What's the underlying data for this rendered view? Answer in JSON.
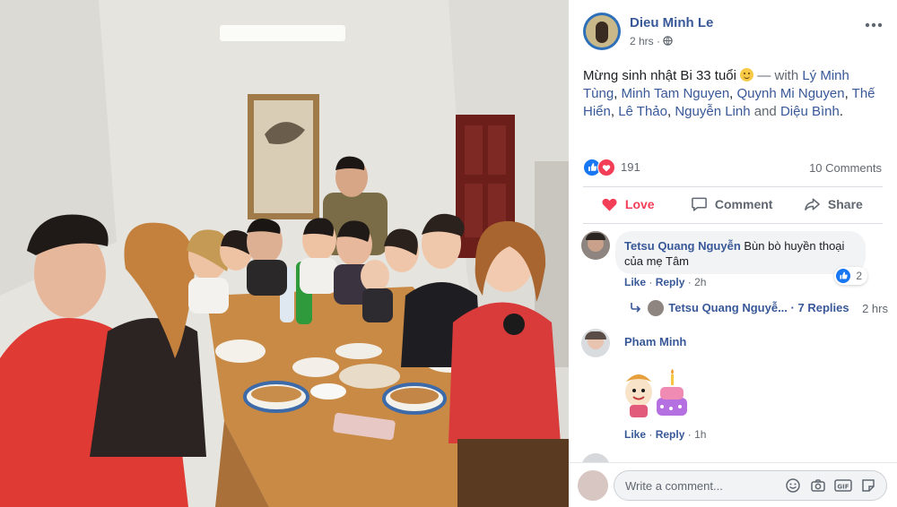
{
  "post": {
    "author": "Dieu Minh Le",
    "time": "2 hrs",
    "caption_main": "Mừng sinh nhật Bi 33 tuổi",
    "with_word": "— with",
    "tagged": [
      "Lý Minh Tùng",
      "Minh Tam Nguyen",
      "Quynh Mi Nguyen",
      "Thế Hiển",
      "Lê Thảo",
      "Nguyễn Linh"
    ],
    "and_word": "and",
    "last_tagged": "Diệu Bình",
    "reaction_count": "191",
    "comments_count": "10 Comments",
    "actions": {
      "love": "Love",
      "comment": "Comment",
      "share": "Share"
    }
  },
  "comments": [
    {
      "author": "Tetsu Quang Nguyễn",
      "text_line1": "Bùn bò huyền thoại",
      "text_line2": "của mẹ Tâm",
      "like": "Like",
      "reply": "Reply",
      "time": "2h",
      "reactions": "2",
      "reply_author": "Tetsu Quang Nguyễ...",
      "replies": "· 7 Replies",
      "reply_time": "2 hrs"
    },
    {
      "author": "Pham Minh",
      "like": "Like",
      "reply": "Reply",
      "time": "1h"
    }
  ],
  "composer": {
    "placeholder": "Write a comment..."
  },
  "colors": {
    "fb_blue": "#385898",
    "love_red": "#f33e58",
    "like_blue": "#1877f2"
  }
}
